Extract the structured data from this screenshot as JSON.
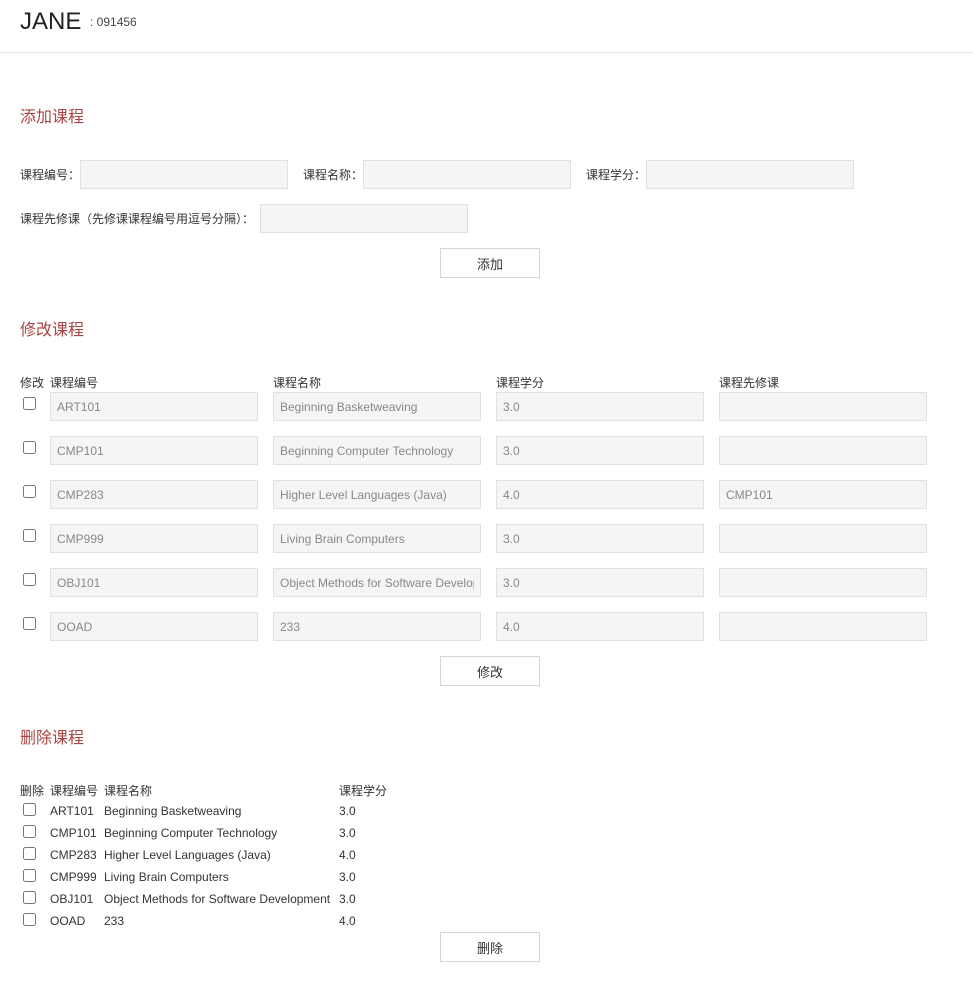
{
  "header": {
    "user_name": "JANE",
    "user_id": ": 091456"
  },
  "add_section": {
    "title": "添加课程",
    "course_id_label": "课程编号：",
    "course_name_label": "课程名称：",
    "course_credit_label": "课程学分：",
    "prereq_label": "课程先修课（先修课课程编号用逗号分隔）：",
    "course_id_value": "",
    "course_name_value": "",
    "course_credit_value": "",
    "prereq_value": "",
    "button_label": "添加"
  },
  "modify_section": {
    "title": "修改课程",
    "headers": {
      "modify": "修改",
      "course_id": "课程编号",
      "course_name": "课程名称",
      "credit": "课程学分",
      "prereq": "课程先修课"
    },
    "rows": [
      {
        "id": "ART101",
        "name": "Beginning Basketweaving",
        "credit": "3.0",
        "prereq": ""
      },
      {
        "id": "CMP101",
        "name": "Beginning Computer Technology",
        "credit": "3.0",
        "prereq": ""
      },
      {
        "id": "CMP283",
        "name": "Higher Level Languages (Java)",
        "credit": "4.0",
        "prereq": "CMP101"
      },
      {
        "id": "CMP999",
        "name": "Living Brain Computers",
        "credit": "3.0",
        "prereq": ""
      },
      {
        "id": "OBJ101",
        "name": "Object Methods for Software Development",
        "credit": "3.0",
        "prereq": ""
      },
      {
        "id": "OOAD",
        "name": "233",
        "credit": "4.0",
        "prereq": ""
      }
    ],
    "button_label": "修改"
  },
  "delete_section": {
    "title": "删除课程",
    "headers": {
      "delete": "删除",
      "course_id": "课程编号",
      "course_name": "课程名称",
      "credit": "课程学分"
    },
    "rows": [
      {
        "id": "ART101",
        "name": "Beginning Basketweaving",
        "credit": "3.0"
      },
      {
        "id": "CMP101",
        "name": "Beginning Computer Technology",
        "credit": "3.0"
      },
      {
        "id": "CMP283",
        "name": "Higher Level Languages (Java)",
        "credit": "4.0"
      },
      {
        "id": "CMP999",
        "name": "Living Brain Computers",
        "credit": "3.0"
      },
      {
        "id": "OBJ101",
        "name": "Object Methods for Software Development",
        "credit": "3.0"
      },
      {
        "id": "OOAD",
        "name": "233",
        "credit": "4.0"
      }
    ],
    "button_label": "删除"
  },
  "colors": {
    "section_title": "#a94442",
    "field_bg": "#f5f5f5",
    "field_border": "#e0e0e0"
  }
}
